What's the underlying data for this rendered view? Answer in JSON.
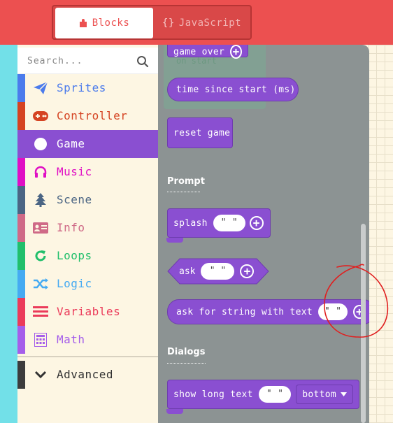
{
  "header": {
    "tabs": [
      {
        "label": "Blocks",
        "icon": "puzzle-icon",
        "active": true
      },
      {
        "label": "JavaScript",
        "icon": "braces-icon",
        "glyph": "{}",
        "active": false
      }
    ]
  },
  "toolbox": {
    "search": {
      "placeholder": "Search..."
    },
    "categories": [
      {
        "label": "Sprites",
        "color": "#4B7BEC",
        "icon": "paper-plane-icon"
      },
      {
        "label": "Controller",
        "color": "#D54322",
        "icon": "gamepad-icon"
      },
      {
        "label": "Game",
        "color": "#8A4FD1",
        "icon": "circle-icon",
        "selected": true
      },
      {
        "label": "Music",
        "color": "#E00FC4",
        "icon": "headphones-icon"
      },
      {
        "label": "Scene",
        "color": "#4B6584",
        "icon": "tree-icon"
      },
      {
        "label": "Info",
        "color": "#CF6A87",
        "icon": "id-card-icon"
      },
      {
        "label": "Loops",
        "color": "#20BF6B",
        "icon": "refresh-icon"
      },
      {
        "label": "Logic",
        "color": "#45AAF2",
        "icon": "shuffle-icon"
      },
      {
        "label": "Variables",
        "color": "#EB3B5A",
        "icon": "list-icon"
      },
      {
        "label": "Math",
        "color": "#A55EEA",
        "icon": "calculator-icon"
      }
    ],
    "advanced": {
      "label": "Advanced",
      "color": "#3c3c3c",
      "icon": "chevron-down-icon"
    }
  },
  "flyout": {
    "ghost_text": "on start",
    "blocks": {
      "game_over": "game over",
      "time_since_start": "time since start (ms)",
      "reset_game": "reset game",
      "splash": "splash",
      "ask": "ask",
      "ask_for_string": "ask for string with text",
      "show_long_text": "show long text",
      "dropdown_value": "bottom",
      "empty_string": "\" \""
    },
    "sections": {
      "prompt": "Prompt",
      "dialogs": "Dialogs"
    }
  },
  "colors": {
    "header": "#EC5050",
    "game_block": "#8A4FD1",
    "flyout": "#8C9393",
    "annotation": "#E02020"
  }
}
